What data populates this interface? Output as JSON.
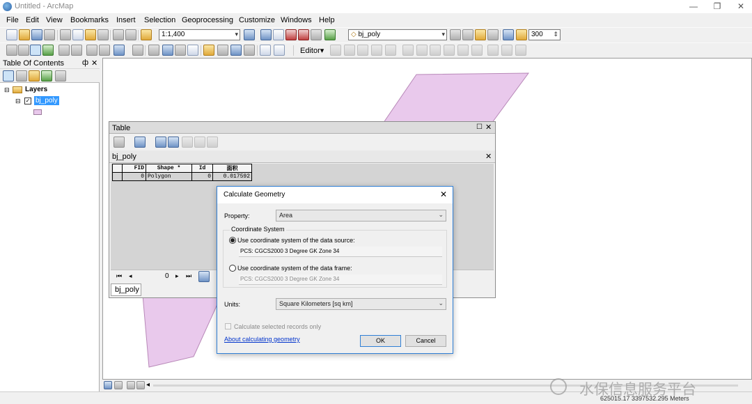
{
  "window": {
    "title": "Untitled - ArcMap",
    "controls": [
      "—",
      "❐",
      "✕"
    ]
  },
  "menu": [
    "File",
    "Edit",
    "View",
    "Bookmarks",
    "Insert",
    "Selection",
    "Geoprocessing",
    "Customize",
    "Windows",
    "Help"
  ],
  "toolbar": {
    "scale": "1:1,400",
    "layer_target": "bj_poly",
    "resolution": "300",
    "editor_label": "Editor▾"
  },
  "toc": {
    "title": "Table Of Contents",
    "pin": "ф",
    "close": "✕",
    "layers_label": "Layers",
    "layer_name": "bj_poly",
    "polygon_color": "#e9c9ec"
  },
  "table_window": {
    "title": "Table",
    "layer_tab": "bj_poly",
    "columns": [
      "FID",
      "Shape *",
      "Id",
      "面积"
    ],
    "rows": [
      [
        "0",
        "Polygon",
        "0",
        "0.017592"
      ]
    ],
    "record_index": "0",
    "bottom_tab": "bj_poly"
  },
  "dialog": {
    "title": "Calculate Geometry",
    "property_label": "Property:",
    "property_value": "Area",
    "coord_group": "Coordinate System",
    "use_source_label": "Use coordinate system of the data source:",
    "source_cs": "PCS: CGCS2000 3 Degree GK Zone 34",
    "use_frame_label": "Use coordinate system of the data frame:",
    "frame_cs": "PCS: CGCS2000 3 Degree GK Zone 34",
    "units_label": "Units:",
    "units_value": "Square Kilometers [sq km]",
    "selected_only_label": "Calculate selected records only",
    "help_link": "About calculating geometry",
    "ok": "OK",
    "cancel": "Cancel"
  },
  "status": {
    "coords": "625015.17  3397532.295 Meters",
    "watermark": "水保信息服务平台"
  },
  "colors": {
    "selection": "#3399ff",
    "polygon": "#e9c9ec",
    "polygon_stroke": "#b888b8",
    "accent": "#2f7fd6"
  }
}
